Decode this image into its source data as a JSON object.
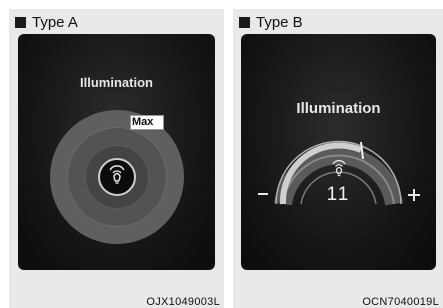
{
  "panels": [
    {
      "header": "Type A",
      "title": "Illumination",
      "level_label": "Max",
      "code": "OJX1049003L"
    },
    {
      "header": "Type B",
      "title": "Illumination",
      "value": "11",
      "code": "OCN7040019L"
    }
  ],
  "icons": [
    "square-bullet-icon",
    "illumination-bulb-icon",
    "minus-icon",
    "plus-icon"
  ],
  "colors": {
    "screen": "#141416",
    "panel": "#e9e9e9",
    "text_light": "#e7e7e7"
  }
}
